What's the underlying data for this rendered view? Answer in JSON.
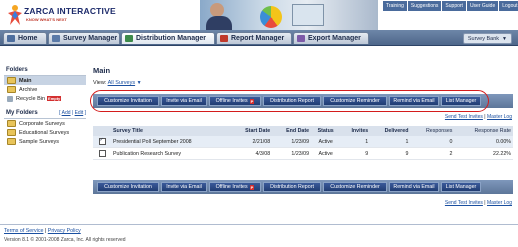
{
  "brand": {
    "name": "ZARCA INTERACTIVE",
    "tagline": "KNOW WHAT'S NEXT"
  },
  "top_links": [
    "Training",
    "Suggestions",
    "Support",
    "User Guide",
    "Logout"
  ],
  "tabs": [
    {
      "label": "Home",
      "active": false
    },
    {
      "label": "Survey Manager",
      "active": false
    },
    {
      "label": "Distribution Manager",
      "active": true
    },
    {
      "label": "Report Manager",
      "active": false
    },
    {
      "label": "Export Manager",
      "active": false
    }
  ],
  "survey_bank": "Survey Bank",
  "sidebar": {
    "folders_heading": "Folders",
    "folders": [
      {
        "label": "Main",
        "selected": true
      },
      {
        "label": "Archive",
        "selected": false
      },
      {
        "label": "Recycle Bin",
        "badge": "Empty",
        "selected": false
      }
    ],
    "my_folders_heading": "My Folders",
    "my_folders_actions": [
      "Add",
      "Edit"
    ],
    "my_folders": [
      "Corporate Surveys",
      "Educational Surveys",
      "Sample Surveys"
    ]
  },
  "main": {
    "title": "Main",
    "view_label": "View:",
    "view_value": "All Surveys",
    "actions": [
      {
        "label": "Customize Invitation"
      },
      {
        "label": "Invite via Email"
      },
      {
        "label": "Offline Invites",
        "badge": "P"
      },
      {
        "label": "Distribution Report"
      },
      {
        "label": "Customize Reminder"
      },
      {
        "label": "Remind via Email"
      },
      {
        "label": "List Manager"
      }
    ],
    "links": [
      "Send Test Invites",
      "Master Log"
    ],
    "table": {
      "headers": [
        "Survey Title",
        "Start Date",
        "End Date",
        "Status",
        "Invites",
        "Delivered",
        "Responses",
        "Response Rate"
      ],
      "rows": [
        {
          "checked": true,
          "cells": [
            "Presidential Poll September 2008",
            "2/21/08",
            "1/23/09",
            "Active",
            "1",
            "1",
            "0",
            "0.00%"
          ]
        },
        {
          "checked": false,
          "cells": [
            "Publication Research Survey",
            "4/3/08",
            "1/23/09",
            "Active",
            "9",
            "9",
            "2",
            "22.22%"
          ]
        }
      ]
    }
  },
  "footer": {
    "links": [
      "Terms of Service",
      "Privacy Policy"
    ],
    "copyright": "Version 8.1 © 2001-2008 Zarca, Inc. All rights reserved"
  },
  "colors": {
    "accent": "#203c73",
    "highlight_ring": "#d41c1c"
  }
}
